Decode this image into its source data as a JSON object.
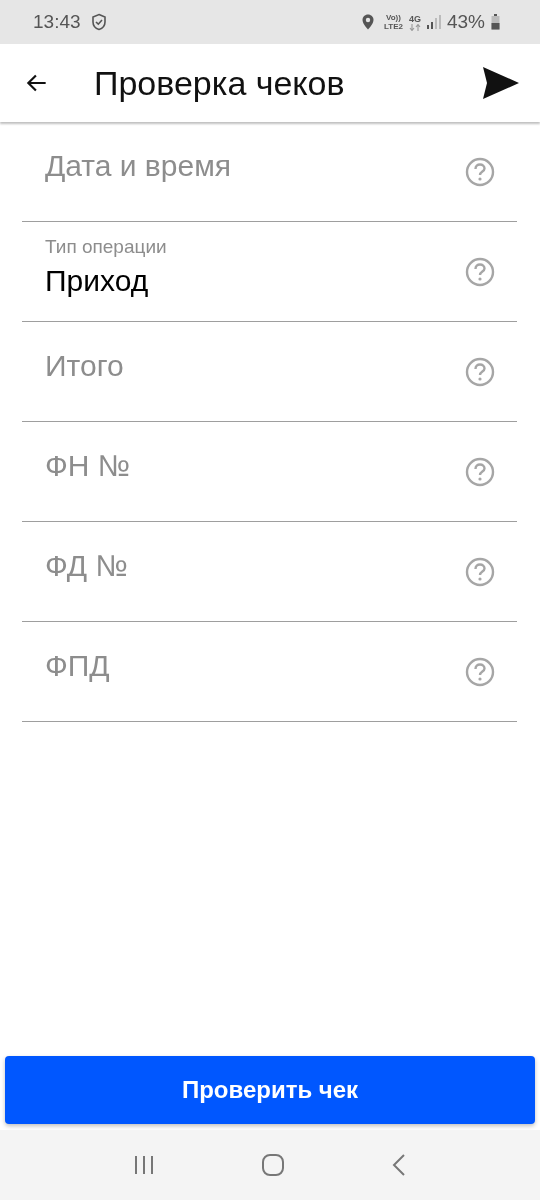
{
  "status_bar": {
    "time": "13:43",
    "volte_top": "Vo))",
    "volte_bottom": "LTE2",
    "network": "4G",
    "battery": "43%"
  },
  "toolbar": {
    "title": "Проверка чеков"
  },
  "fields": [
    {
      "kind": "empty",
      "placeholder": "Дата и время"
    },
    {
      "kind": "filled",
      "label": "Тип операции",
      "value": "Приход"
    },
    {
      "kind": "empty",
      "placeholder": "Итого"
    },
    {
      "kind": "empty",
      "placeholder": "ФН №"
    },
    {
      "kind": "empty",
      "placeholder": "ФД №"
    },
    {
      "kind": "empty",
      "placeholder": "ФПД"
    }
  ],
  "submit_button": {
    "label": "Проверить чек"
  }
}
